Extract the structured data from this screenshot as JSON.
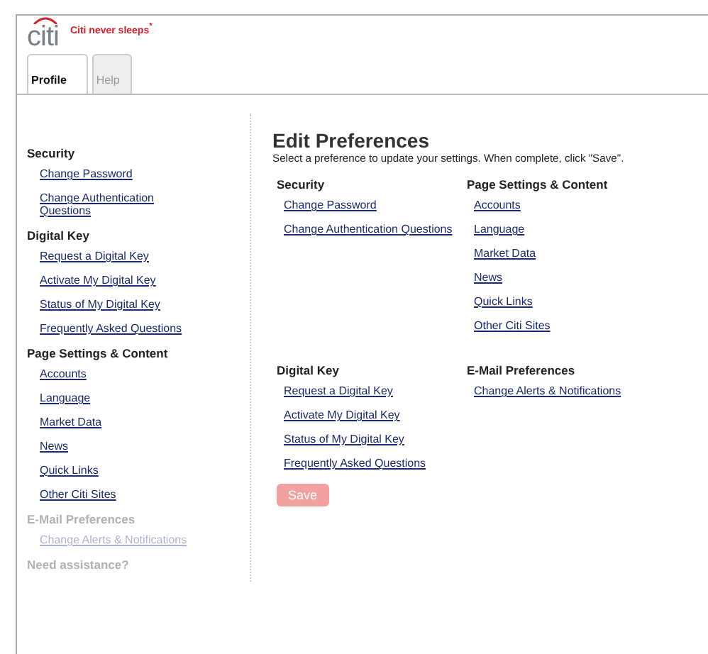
{
  "brand": {
    "logo": "citi",
    "tagline": "Citi never sleeps",
    "tagline_mark": "*"
  },
  "tabs": [
    {
      "label": "Profile",
      "selected": true
    },
    {
      "label": "Help",
      "selected": false
    }
  ],
  "sidebar": {
    "groups": [
      {
        "title": "Security",
        "faded": false,
        "links": [
          "Change Password",
          "Change Authentication Questions"
        ]
      },
      {
        "title": "Digital Key",
        "faded": false,
        "links": [
          "Request a Digital Key",
          "Activate My Digital Key",
          "Status of My Digital Key",
          "Frequently Asked Questions"
        ]
      },
      {
        "title": "Page Settings & Content",
        "faded": false,
        "links": [
          "Accounts",
          "Language",
          "Market Data",
          "News",
          "Quick Links",
          "Other Citi Sites"
        ]
      },
      {
        "title": "E-Mail Preferences",
        "faded": true,
        "links": [
          "Change Alerts & Notifications"
        ]
      },
      {
        "title": "Need assistance?",
        "faded": true
      }
    ]
  },
  "main": {
    "title": "Edit Preferences",
    "subtitle": "Select a preference to update your settings. When complete, click \"Save\".",
    "sections": [
      {
        "title": "Security",
        "links": [
          "Change Password",
          "Change Authentication Questions"
        ]
      },
      {
        "title": "Page Settings & Content",
        "links": [
          "Accounts",
          "Language",
          "Market Data",
          "News",
          "Quick Links",
          "Other Citi Sites"
        ]
      },
      {
        "title": "Digital Key",
        "links": [
          "Request a Digital Key",
          "Activate My Digital Key",
          "Status of My Digital Key",
          "Frequently Asked Questions"
        ]
      },
      {
        "title": "E-Mail Preferences",
        "links": [
          "Change Alerts & Notifications"
        ]
      }
    ],
    "save": {
      "label": "Save",
      "disabled": true
    }
  }
}
